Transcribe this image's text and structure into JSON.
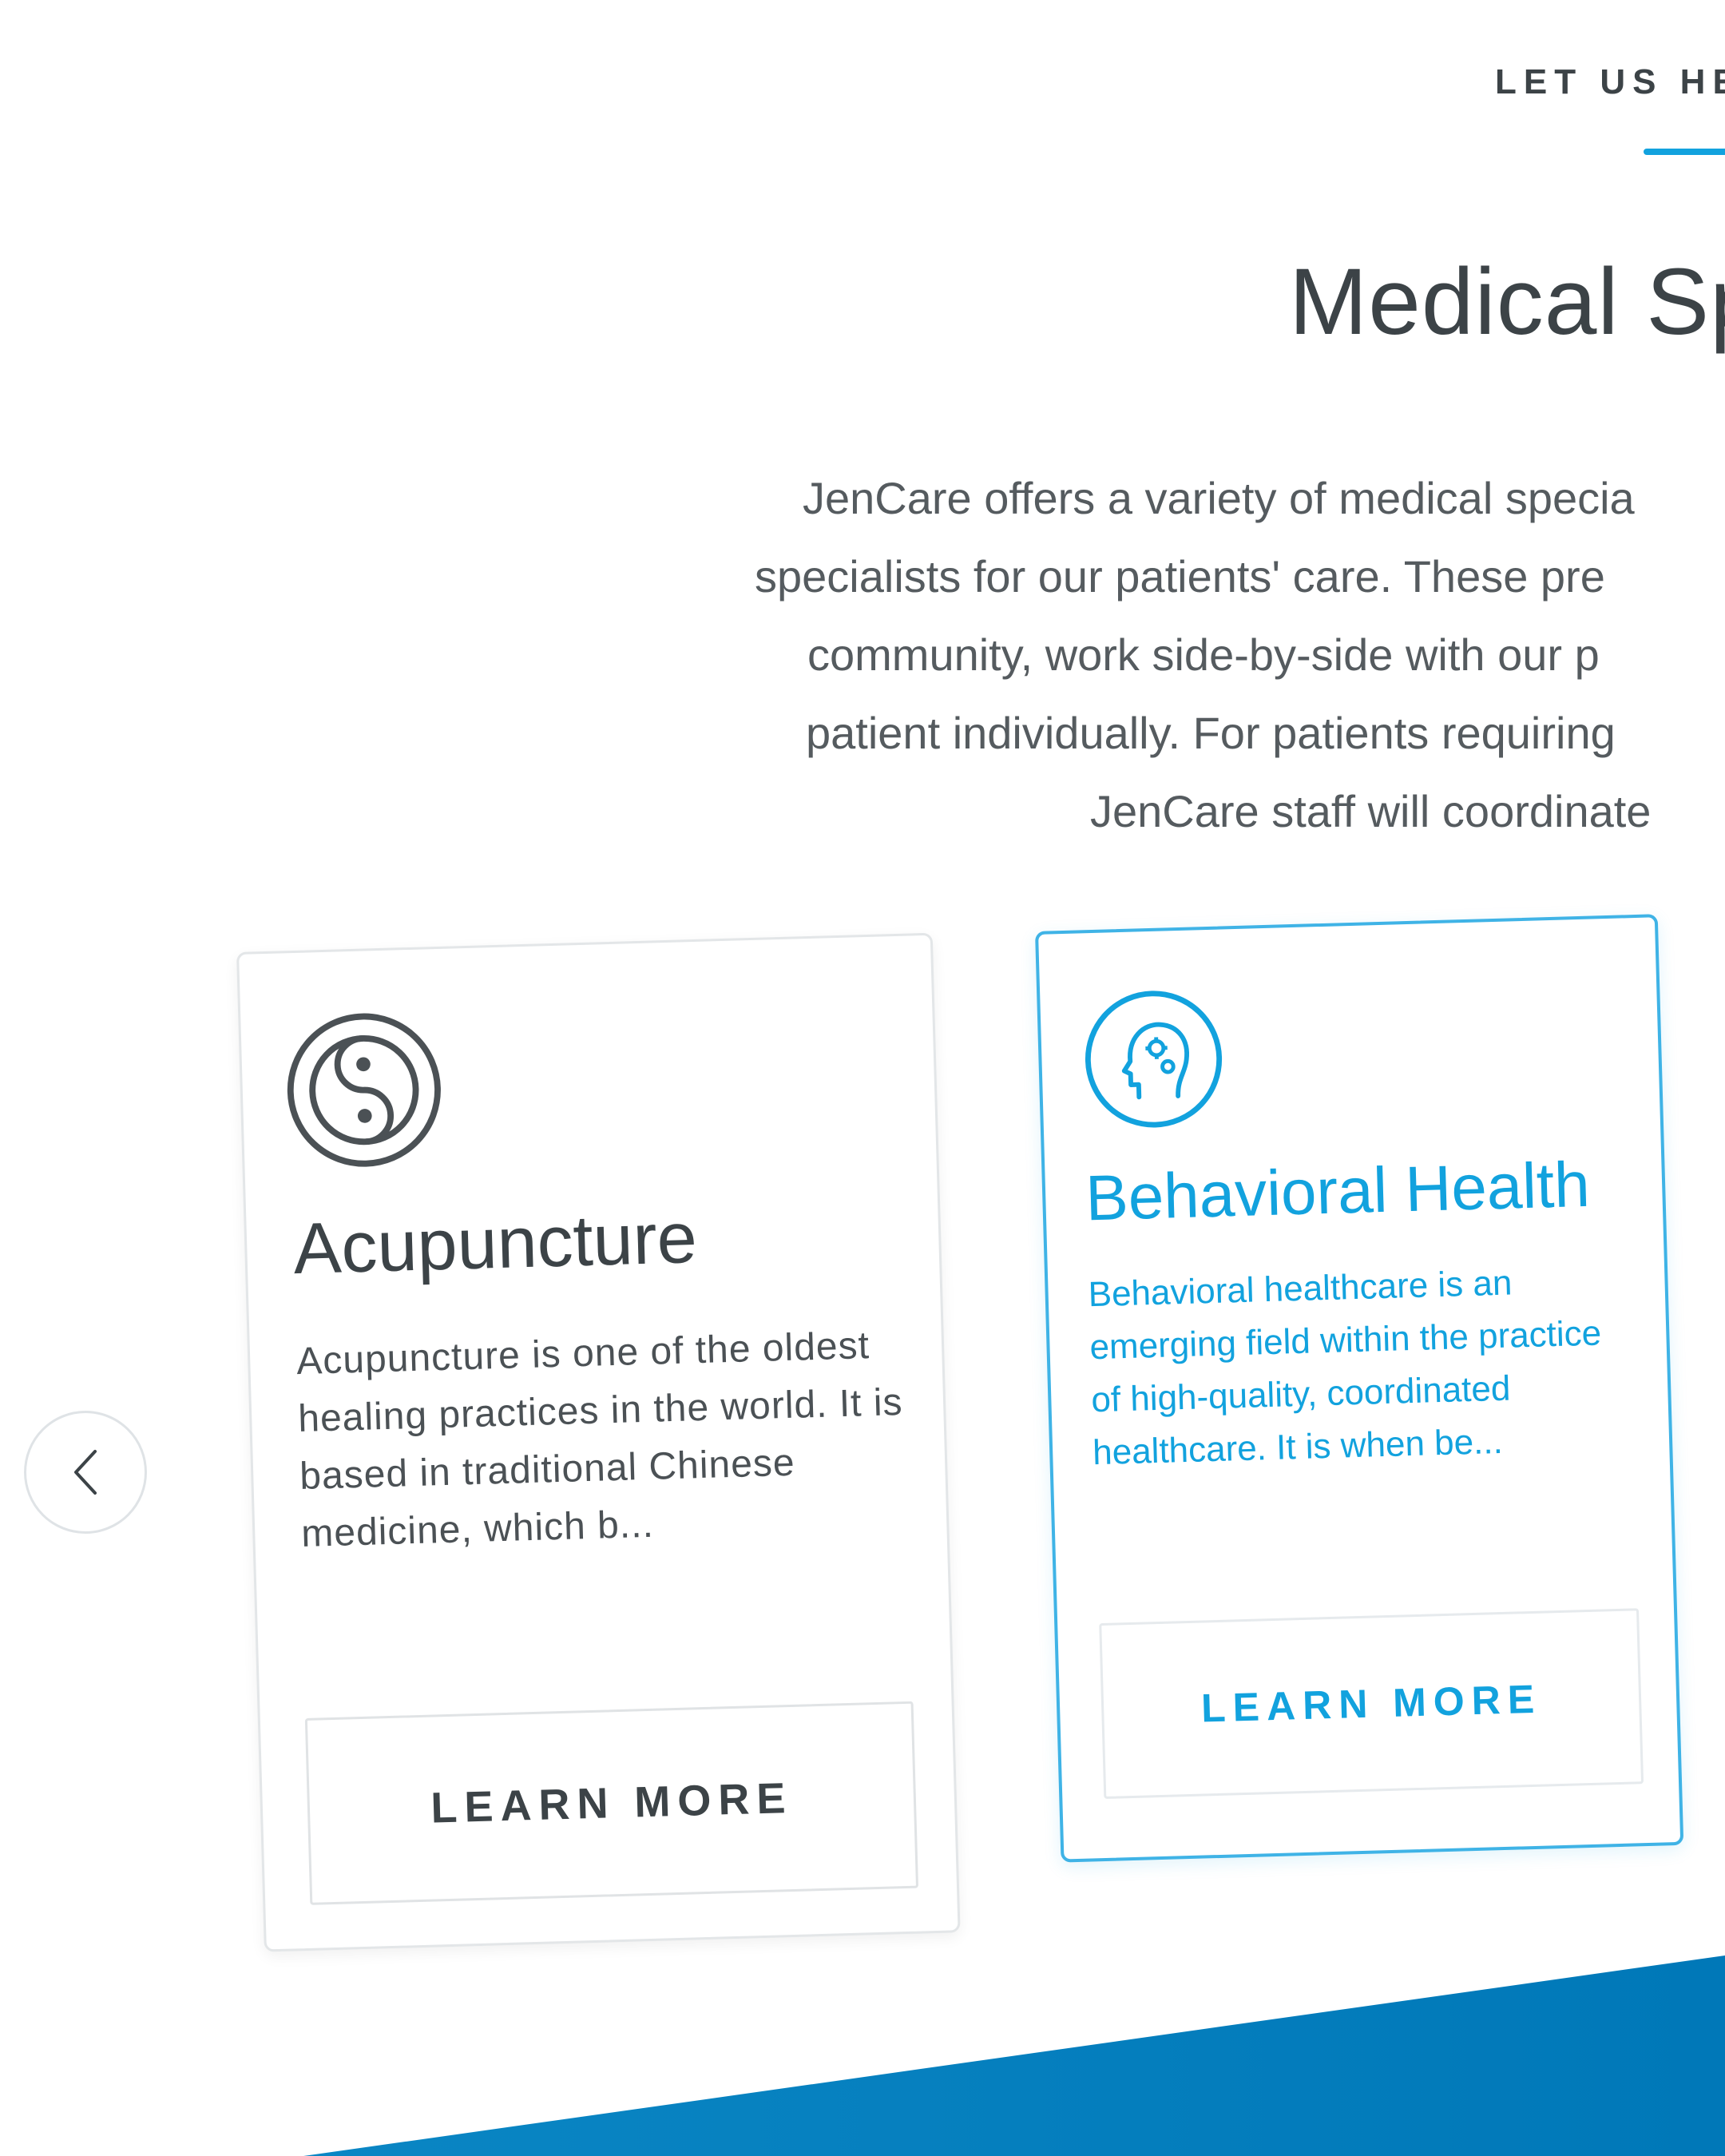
{
  "section": {
    "eyebrow": "LET US HE",
    "title": "Medical Sp",
    "intro_lines": [
      "JenCare offers a variety of medical specia",
      "specialists for our patients' care. These pre",
      "community, work side-by-side with our p",
      "patient individually. For patients requiring",
      "JenCare staff will coordinate"
    ]
  },
  "carousel": {
    "prev_icon": "chevron-left-icon",
    "cards": [
      {
        "title": "Acupuncture",
        "description": "Acupuncture is one of the oldest healing practices in the world. It is based in traditional Chinese medicine, which b...",
        "button_label": "LEARN MORE",
        "icon": "yin-yang-icon"
      },
      {
        "title": "Behavioral Health",
        "description": "Behavioral healthcare is an emerging field within the practice of high-quality, coordinated healthcare. It is when be...",
        "button_label": "LEARN MORE",
        "icon": "head-gears-icon"
      }
    ]
  },
  "colors": {
    "accent": "#12a2de",
    "text_dark": "#3c4347",
    "text_body": "#555b5f",
    "footer_band": "#0a86c4"
  }
}
